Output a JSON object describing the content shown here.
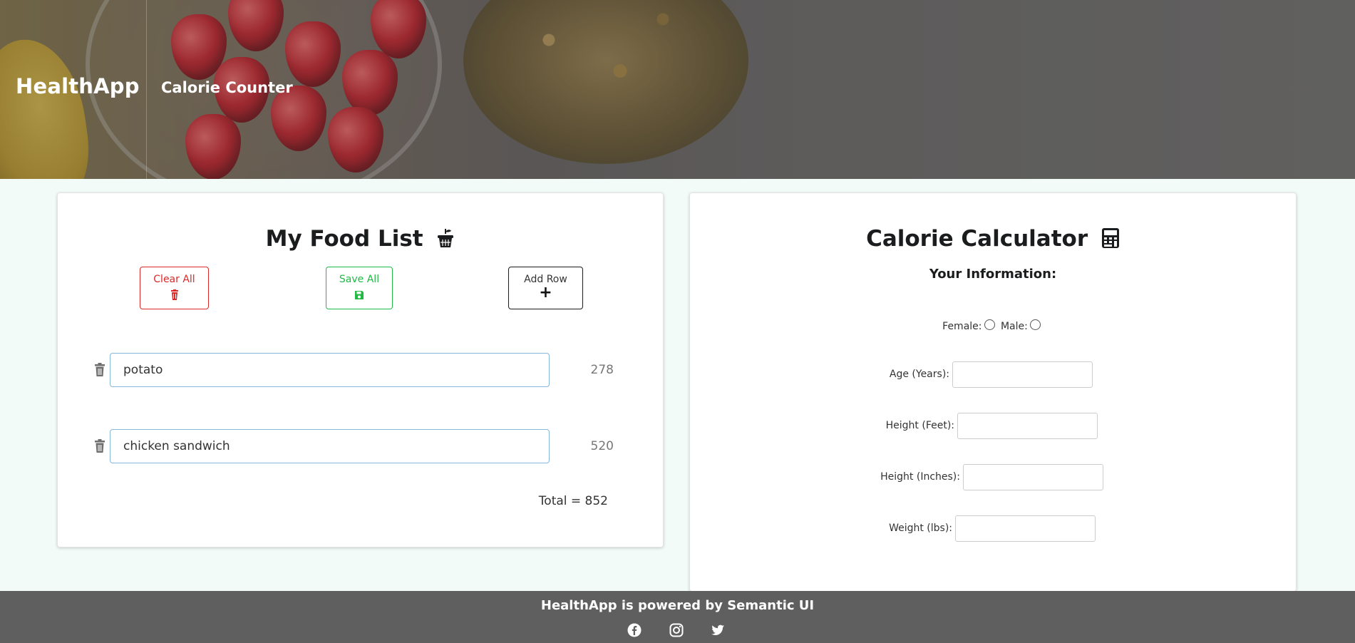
{
  "header": {
    "brand": "HealthApp",
    "nav_link": "Calorie Counter"
  },
  "food_list": {
    "title": "My Food List",
    "title_icon": "basket-icon",
    "buttons": {
      "clear_all": "Clear All",
      "save_all": "Save All",
      "add_row": "Add Row"
    },
    "rows": [
      {
        "food": "potato",
        "calories": "278"
      },
      {
        "food": "chicken sandwich",
        "calories": "520"
      }
    ],
    "total": "Total = 852"
  },
  "calculator": {
    "title": "Calorie Calculator",
    "title_icon": "calculator-icon",
    "subtitle": "Your Information:",
    "gender": {
      "female_label": "Female:",
      "male_label": "Male:"
    },
    "fields": {
      "age": "Age (Years):",
      "height_feet": "Height (Feet):",
      "height_inches": "Height (Inches):",
      "weight": "Weight (lbs):"
    }
  },
  "footer": {
    "text": "HealthApp is powered by Semantic UI",
    "social_icons": [
      "facebook-icon",
      "instagram-icon",
      "twitter-icon"
    ]
  },
  "colors": {
    "danger": "#db2828",
    "success": "#21ba45",
    "input_focus_border": "#85b7d9",
    "page_background": "#f2fbf7",
    "footer_background": "#5f5f5f"
  }
}
